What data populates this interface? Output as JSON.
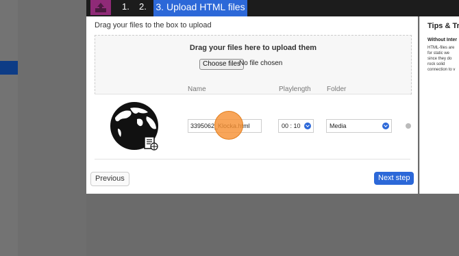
{
  "wizard": {
    "steps": [
      {
        "label": "1."
      },
      {
        "label": "2."
      },
      {
        "label": "3. Upload HTML files"
      }
    ]
  },
  "dialog": {
    "instruction": "Drag your files to the box to upload",
    "dropzone_text": "Drag your files here to upload them",
    "choose_button": "Choose files",
    "no_file": "No file chosen",
    "columns": {
      "name": "Name",
      "playlength": "Playlength",
      "folder": "Folder"
    },
    "file": {
      "name_value": "3395062_Klocka.html",
      "duration_value": "00 : 10",
      "folder_value": "Media"
    },
    "prev_button": "Previous",
    "next_button": "Next step"
  },
  "tips": {
    "title": "Tips & Tric",
    "subtitle": "Without Inter",
    "body_lines": [
      "HTML-files are",
      "for static we",
      "since they do",
      "rock solid",
      "connection to v"
    ]
  },
  "colors": {
    "accent": "#2c68d8",
    "logo": "#8f2a77",
    "cursor": "#f69134"
  },
  "icons": [
    "upload-icon",
    "globe-html-icon",
    "chevron-down-icon",
    "more-icon"
  ]
}
